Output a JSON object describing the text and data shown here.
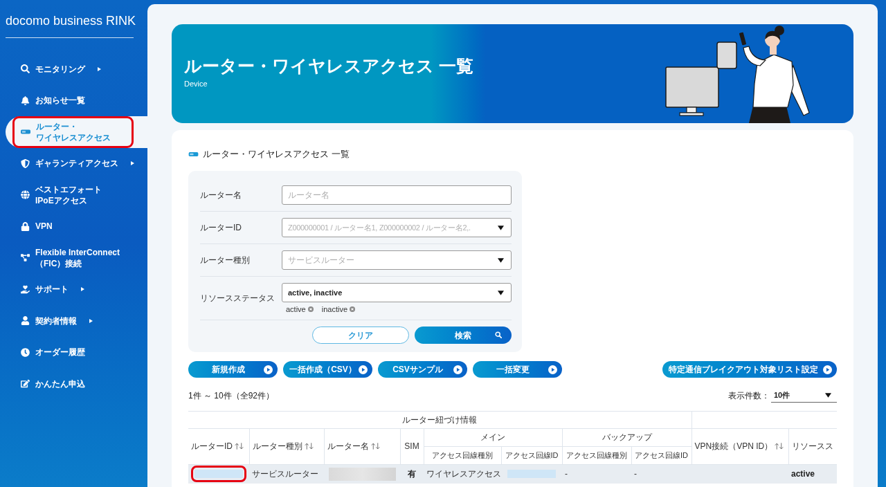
{
  "sidebar": {
    "logo": "docomo business RINK",
    "items": [
      {
        "label": "モニタリング",
        "expandable": true,
        "selected": false,
        "highlighted": false
      },
      {
        "label": "お知らせ一覧",
        "expandable": false,
        "selected": false,
        "highlighted": false
      },
      {
        "label": "ルーター・ワイヤレスアクセス",
        "expandable": false,
        "selected": true,
        "highlighted": true
      },
      {
        "label": "ギャランティアクセス",
        "expandable": true,
        "selected": false,
        "highlighted": false
      },
      {
        "label": "ベストエフォート\nIPoEアクセス",
        "expandable": false,
        "selected": false,
        "highlighted": false
      },
      {
        "label": "VPN",
        "expandable": false,
        "selected": false,
        "highlighted": false
      },
      {
        "label": "Flexible InterConnect\n（FIC）接続",
        "expandable": false,
        "selected": false,
        "highlighted": false
      },
      {
        "label": "サポート",
        "expandable": true,
        "selected": false,
        "highlighted": false
      },
      {
        "label": "契約者情報",
        "expandable": true,
        "selected": false,
        "highlighted": false
      },
      {
        "label": "オーダー履歴",
        "expandable": false,
        "selected": false,
        "highlighted": false
      },
      {
        "label": "かんたん申込",
        "expandable": false,
        "selected": false,
        "highlighted": false
      }
    ]
  },
  "banner": {
    "title": "ルーター・ワイヤレスアクセス 一覧",
    "subtitle": "Device"
  },
  "card": {
    "title": "ルーター・ワイヤレスアクセス 一覧"
  },
  "search_form": {
    "fields": [
      {
        "label": "ルーター名",
        "kind": "text",
        "placeholder": "ルーター名"
      },
      {
        "label": "ルーターID",
        "kind": "select",
        "placeholder": "Z000000001 / ルーター名1, Z000000002 / ルーター名2,."
      },
      {
        "label": "ルーター種別",
        "kind": "select",
        "placeholder": "サービスルーター"
      },
      {
        "label": "リソースステータス",
        "kind": "multiselect",
        "value": "active, inactive",
        "chips": [
          "active",
          "inactive"
        ]
      }
    ],
    "buttons": [
      {
        "label": "クリア",
        "kind": "secondary"
      },
      {
        "label": "検索",
        "kind": "primary"
      }
    ]
  },
  "actions": [
    "新規作成",
    "一括作成（CSV）",
    "CSVサンプル",
    "一括変更"
  ],
  "side_action": "特定通信ブレイクアウト対象リスト設定",
  "result_count": "1件 ～ 10件（全92件）",
  "page_size": {
    "label": "表示件数：",
    "value": "10件"
  },
  "table": {
    "header_groups": [
      {
        "label": "ルーター紐づけ情報",
        "columns": [
          {
            "label": "ルーターID",
            "sortable": true
          },
          {
            "label": "ルーター種別",
            "sortable": true
          },
          {
            "label": "ルーター名",
            "sortable": true
          },
          {
            "label": "SIM",
            "sortable": false
          },
          {
            "label": "メイン",
            "children": [
              "アクセス回線種別",
              "アクセス回線ID"
            ]
          },
          {
            "label": "バックアップ",
            "children": [
              "アクセス回線種別",
              "アクセス回線ID"
            ]
          }
        ]
      },
      {
        "columns": [
          {
            "label": "VPN接続（VPN ID）",
            "sortable": true
          },
          {
            "label": "リソースス",
            "sortable": false
          }
        ]
      }
    ],
    "rows": [
      {
        "cells": [
          {
            "kind": "redacted-link",
            "highlighted": true
          },
          {
            "kind": "text",
            "text": "サービスルーター",
            "highlighted": false
          },
          {
            "kind": "redacted",
            "highlighted": false
          },
          {
            "kind": "strong",
            "text": "有",
            "highlighted": false
          },
          {
            "kind": "text",
            "text": "ワイヤレスアクセス",
            "highlighted": false
          },
          {
            "kind": "redacted-link",
            "highlighted": false
          },
          {
            "kind": "text",
            "text": "-",
            "highlighted": false
          },
          {
            "kind": "text",
            "text": "-",
            "highlighted": false
          },
          {
            "kind": "empty",
            "highlighted": false
          },
          {
            "kind": "strong",
            "text": "active",
            "highlighted": false
          }
        ]
      }
    ]
  }
}
